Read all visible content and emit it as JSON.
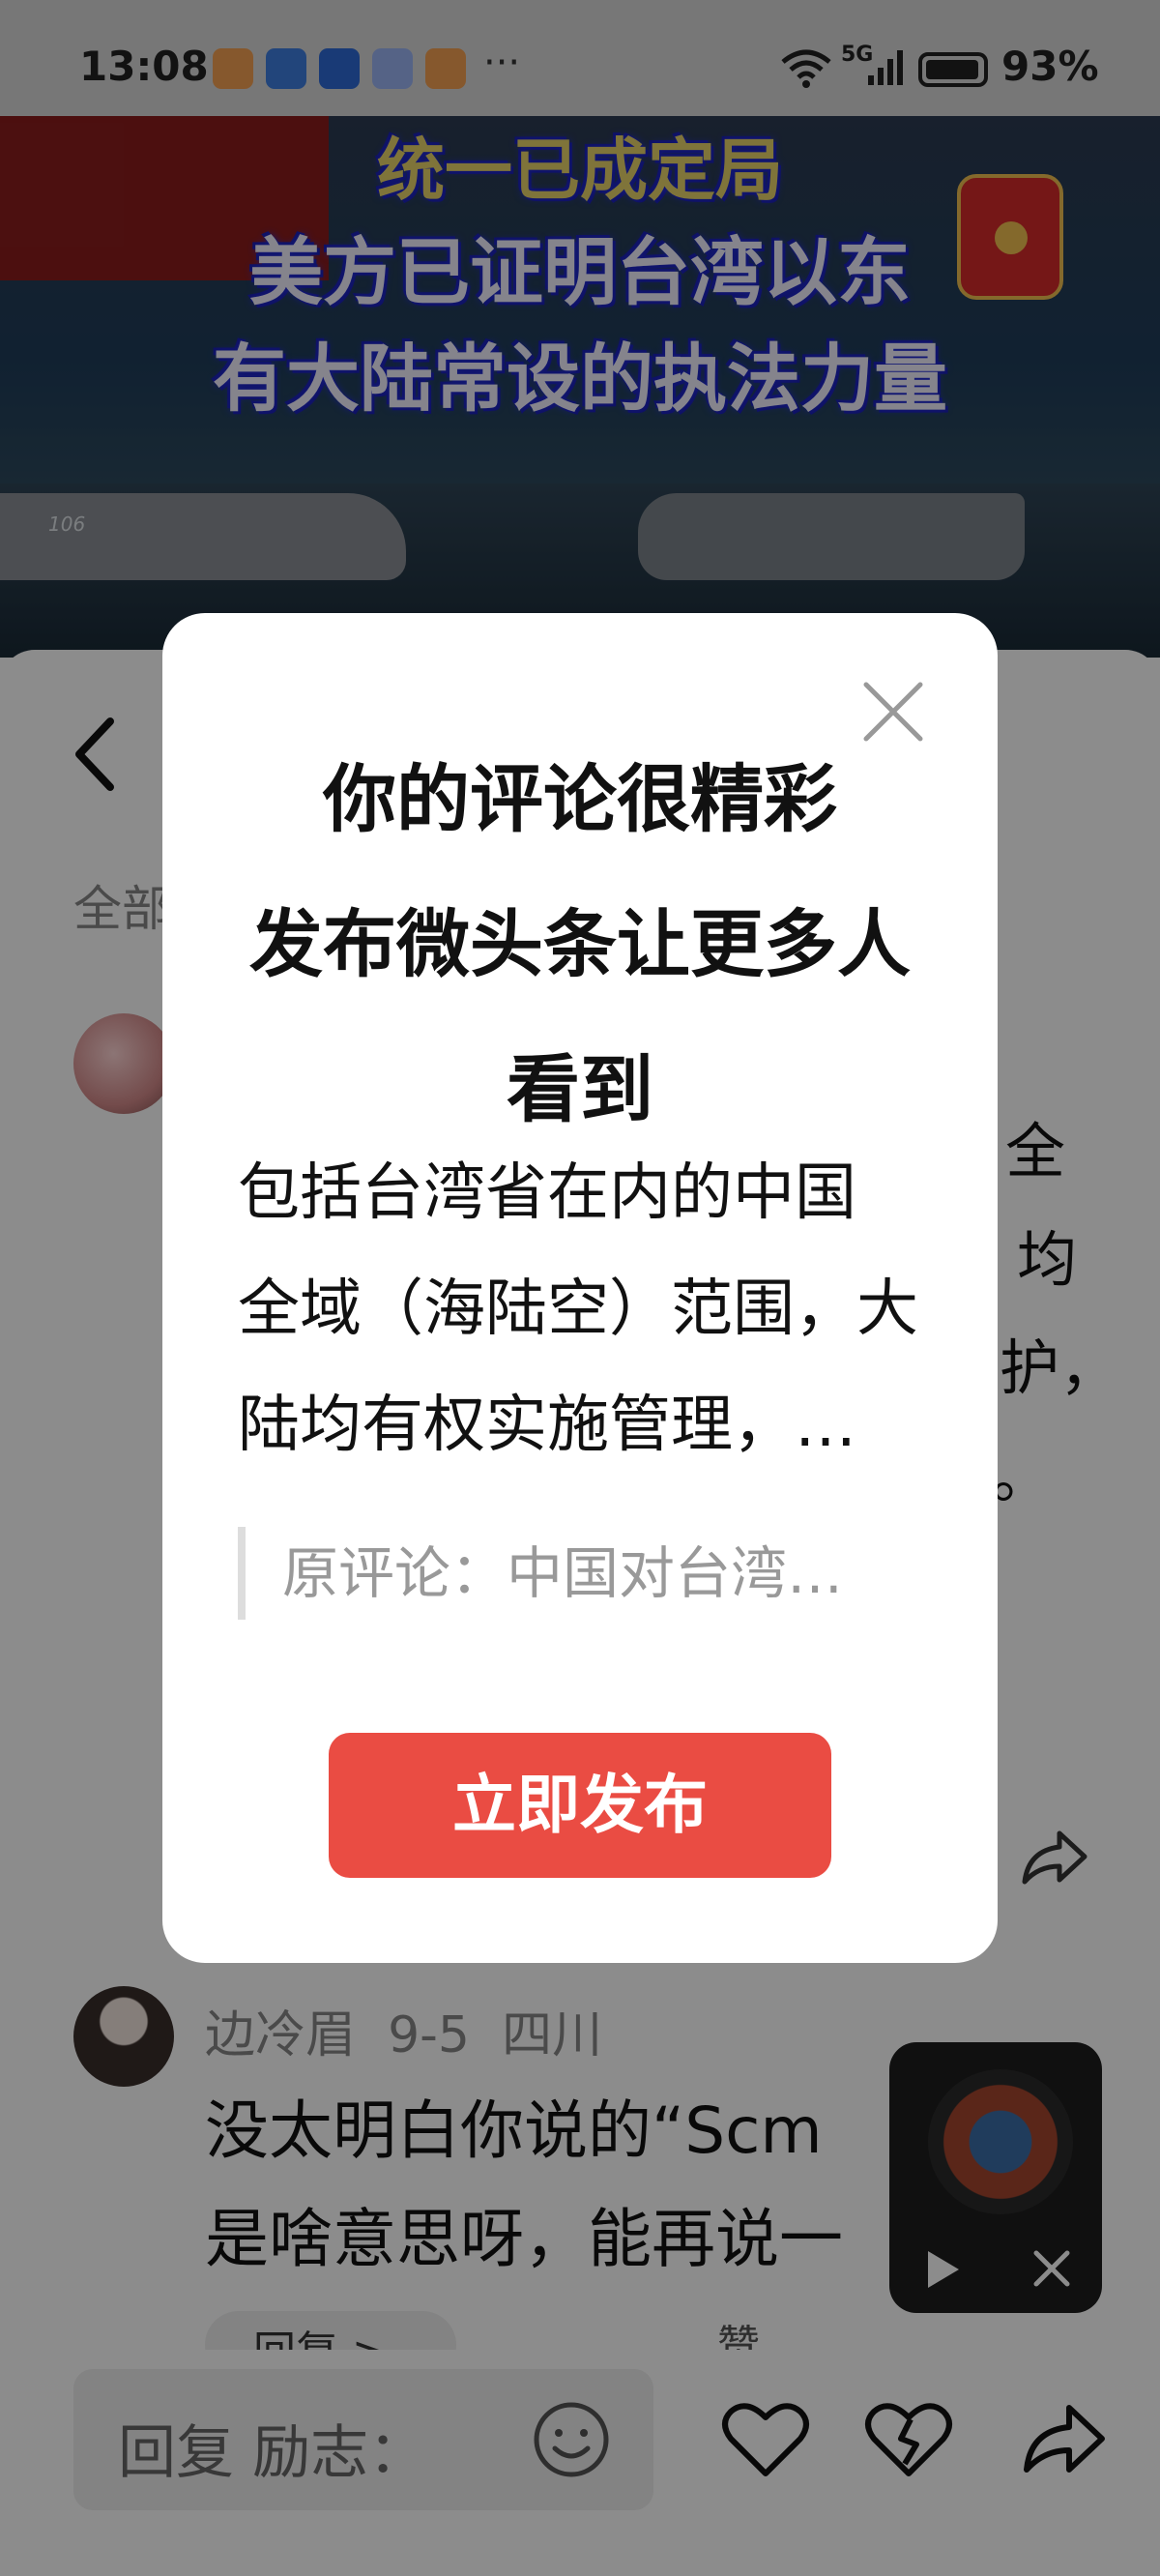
{
  "status_bar": {
    "time": "13:08",
    "network": "5G",
    "battery": "93%",
    "more_indicator": "···"
  },
  "video": {
    "caption_line1": "统一已成定局",
    "caption_line2": "美方已证明台湾以东",
    "caption_line3": "有大陆常设的执法力量",
    "hull_number": "106"
  },
  "page": {
    "tab_all": "全部",
    "fragment_lines": [
      "全",
      "均",
      "护，",
      "。"
    ]
  },
  "comment2": {
    "author": "边冷眉",
    "date": "9-5",
    "location": "四川",
    "line1": "没太明白你说的“Scm",
    "line2": "是啥意思呀，能再说一",
    "reply_label": "回复 >",
    "like_label": "赞"
  },
  "bottom_bar": {
    "reply_placeholder": "回复 励志："
  },
  "dialog": {
    "title_lines": [
      "你的评论很精彩",
      "发布微头条让更多人",
      "看到"
    ],
    "body_lines": [
      "包括台湾省在内的中国",
      "全域（海陆空）范围，大",
      "陆均有权实施管理，…"
    ],
    "original_comment": "原评论：中国对台湾…",
    "publish_button": "立即发布"
  },
  "colors": {
    "accent_red": "#ea4c43",
    "mask": "rgba(0,0,0,0.45)"
  },
  "icons": [
    "heart-icon",
    "app-market-icon",
    "message-icon",
    "wifi-icon",
    "signal-icon",
    "battery-icon",
    "back-icon",
    "share-icon",
    "like-icon",
    "dislike-icon",
    "smile-icon",
    "close-icon",
    "play-icon"
  ]
}
